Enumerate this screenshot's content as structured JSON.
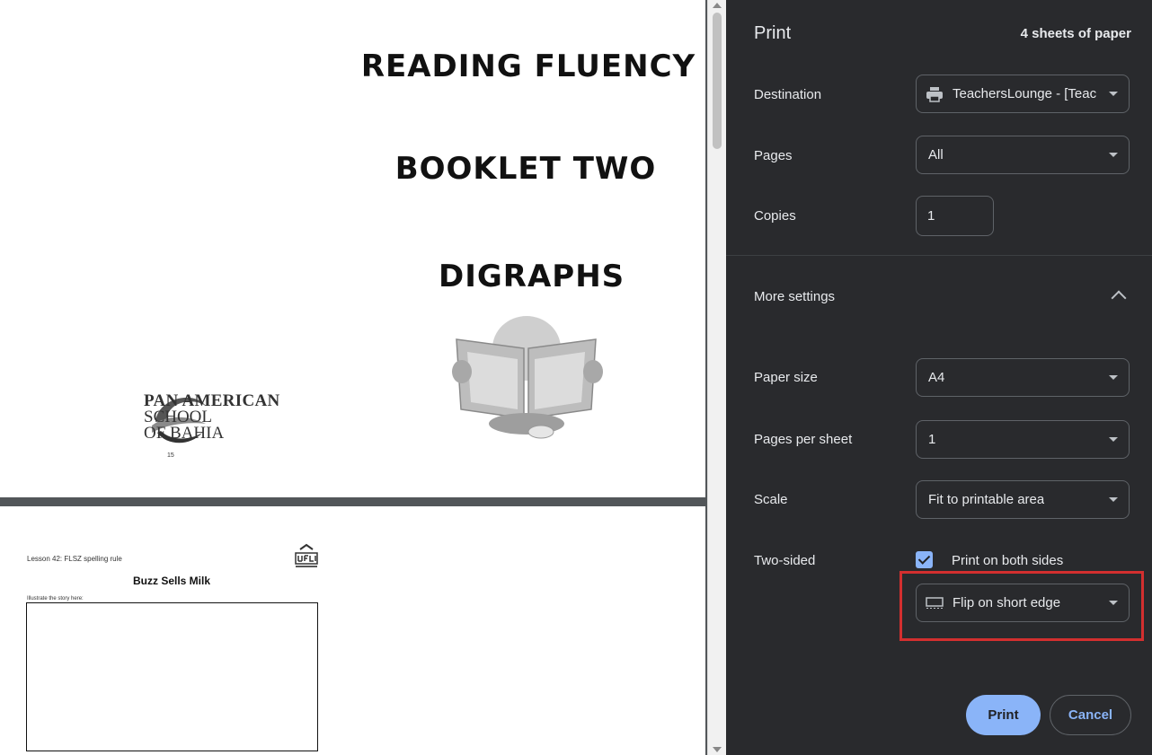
{
  "preview": {
    "page1": {
      "title_line1": "READING FLUENCY",
      "title_line2": "BOOKLET TWO",
      "title_line3": "DIGRAPHS",
      "school_line1": "PAN AMERICAN",
      "school_line2": "SCHOOL",
      "school_line3": "OF BAHIA",
      "page_number": "15"
    },
    "page2": {
      "lesson": "Lesson 42: FLSZ spelling rule",
      "story_title": "Buzz Sells Milk",
      "illustrate_prompt": "Illustrate the story here:"
    }
  },
  "panel": {
    "title": "Print",
    "sheets": "4 sheets of paper",
    "destination": {
      "label": "Destination",
      "value": "TeachersLounge - [Teach",
      "icon": "printer-icon"
    },
    "pages": {
      "label": "Pages",
      "value": "All"
    },
    "copies": {
      "label": "Copies",
      "value": "1"
    },
    "more_settings": {
      "label": "More settings",
      "expanded": true
    },
    "paper_size": {
      "label": "Paper size",
      "value": "A4"
    },
    "pages_per_sheet": {
      "label": "Pages per sheet",
      "value": "1"
    },
    "scale": {
      "label": "Scale",
      "value": "Fit to printable area"
    },
    "two_sided": {
      "label": "Two-sided",
      "checkbox_label": "Print on both sides",
      "checked": true,
      "mode": "Flip on short edge",
      "icon": "short-edge-flip-icon"
    },
    "print_button": "Print",
    "cancel_button": "Cancel"
  },
  "colors": {
    "panel_bg": "#292a2d",
    "accent": "#8ab4f8",
    "highlight": "#d32f2f"
  }
}
